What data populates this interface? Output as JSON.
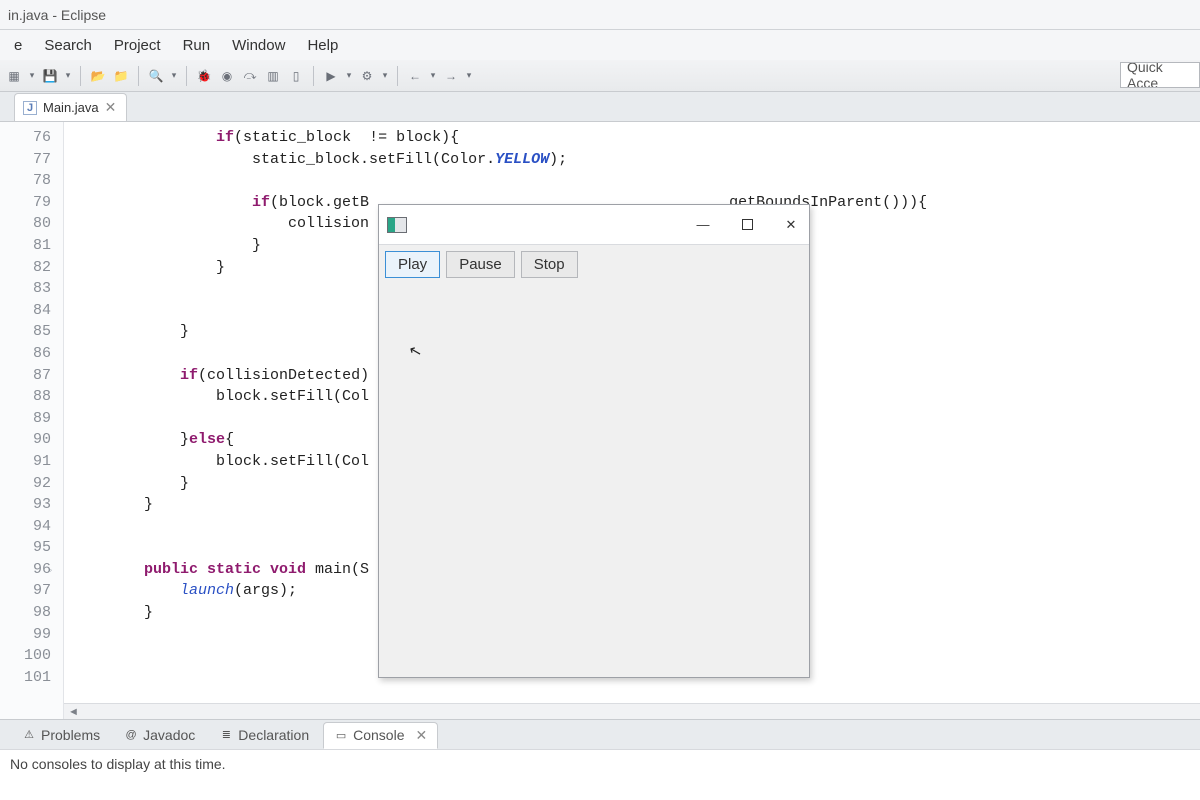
{
  "title": "in.java - Eclipse",
  "menu": [
    "e",
    "Search",
    "Project",
    "Run",
    "Window",
    "Help"
  ],
  "quick_access_placeholder": "Quick Acce",
  "file_tab": {
    "label": "Main.java"
  },
  "line_numbers": [
    "76",
    "77",
    "78",
    "79",
    "80",
    "81",
    "82",
    "83",
    "84",
    "85",
    "86",
    "87",
    "88",
    "89",
    "90",
    "91",
    "92",
    "93",
    "94",
    "95",
    "96",
    "97",
    "98",
    "99",
    "100",
    "101"
  ],
  "override_line": "96",
  "code_lines": [
    {
      "indent": 16,
      "tokens": [
        {
          "t": "kw",
          "v": "if"
        },
        {
          "t": "plain",
          "v": "(static_block  != block){"
        }
      ]
    },
    {
      "indent": 20,
      "tokens": [
        {
          "t": "plain",
          "v": "static_block.setFill(Color."
        },
        {
          "t": "const-field",
          "v": "YELLOW"
        },
        {
          "t": "plain",
          "v": ");"
        }
      ]
    },
    {
      "indent": 0,
      "tokens": []
    },
    {
      "indent": 20,
      "tokens": [
        {
          "t": "kw",
          "v": "if"
        },
        {
          "t": "plain",
          "v": "(block.getB                                        getBoundsInParent())){"
        }
      ]
    },
    {
      "indent": 24,
      "tokens": [
        {
          "t": "plain",
          "v": "collision"
        }
      ]
    },
    {
      "indent": 20,
      "tokens": [
        {
          "t": "plain",
          "v": "}"
        }
      ]
    },
    {
      "indent": 16,
      "tokens": [
        {
          "t": "plain",
          "v": "}"
        }
      ]
    },
    {
      "indent": 0,
      "tokens": []
    },
    {
      "indent": 0,
      "tokens": []
    },
    {
      "indent": 12,
      "tokens": [
        {
          "t": "plain",
          "v": "}"
        }
      ]
    },
    {
      "indent": 0,
      "tokens": []
    },
    {
      "indent": 12,
      "tokens": [
        {
          "t": "kw",
          "v": "if"
        },
        {
          "t": "plain",
          "v": "(collisionDetected)"
        }
      ]
    },
    {
      "indent": 16,
      "tokens": [
        {
          "t": "plain",
          "v": "block.setFill(Col"
        }
      ]
    },
    {
      "indent": 0,
      "tokens": []
    },
    {
      "indent": 12,
      "tokens": [
        {
          "t": "plain",
          "v": "}"
        },
        {
          "t": "kw",
          "v": "else"
        },
        {
          "t": "plain",
          "v": "{"
        }
      ]
    },
    {
      "indent": 16,
      "tokens": [
        {
          "t": "plain",
          "v": "block.setFill(Col"
        }
      ]
    },
    {
      "indent": 12,
      "tokens": [
        {
          "t": "plain",
          "v": "}"
        }
      ]
    },
    {
      "indent": 8,
      "tokens": [
        {
          "t": "plain",
          "v": "}"
        }
      ]
    },
    {
      "indent": 0,
      "tokens": []
    },
    {
      "indent": 0,
      "tokens": []
    },
    {
      "indent": 8,
      "tokens": [
        {
          "t": "kw",
          "v": "public static void"
        },
        {
          "t": "plain",
          "v": " main(S"
        }
      ]
    },
    {
      "indent": 12,
      "tokens": [
        {
          "t": "static-field",
          "v": "launch"
        },
        {
          "t": "plain",
          "v": "(args);"
        }
      ]
    },
    {
      "indent": 8,
      "tokens": [
        {
          "t": "plain",
          "v": "}"
        }
      ]
    },
    {
      "indent": 0,
      "tokens": []
    },
    {
      "indent": 0,
      "tokens": []
    },
    {
      "indent": 0,
      "tokens": []
    }
  ],
  "bottom_tabs": [
    {
      "label": "Problems",
      "icon": "⚠",
      "active": false
    },
    {
      "label": "Javadoc",
      "icon": "@",
      "active": false
    },
    {
      "label": "Declaration",
      "icon": "≣",
      "active": false
    },
    {
      "label": "Console",
      "icon": "▭",
      "active": true
    }
  ],
  "console_message": "No consoles to display at this time.",
  "app_window": {
    "buttons": [
      {
        "label": "Play",
        "selected": true
      },
      {
        "label": "Pause",
        "selected": false
      },
      {
        "label": "Stop",
        "selected": false
      }
    ]
  },
  "toolbar_icons": [
    "new-icon",
    "dropdown",
    "save-icon",
    "dropdown",
    "sep",
    "open-type-icon",
    "package-icon",
    "sep",
    "search-icon",
    "dropdown",
    "sep",
    "debug-last-icon",
    "toggle-breakpoint-icon",
    "skip-icon",
    "coverage-icon",
    "toggle-mark-icon",
    "sep",
    "run-icon",
    "dropdown",
    "external-icon",
    "dropdown",
    "sep",
    "back-icon",
    "dropdown",
    "forward-icon",
    "dropdown"
  ]
}
